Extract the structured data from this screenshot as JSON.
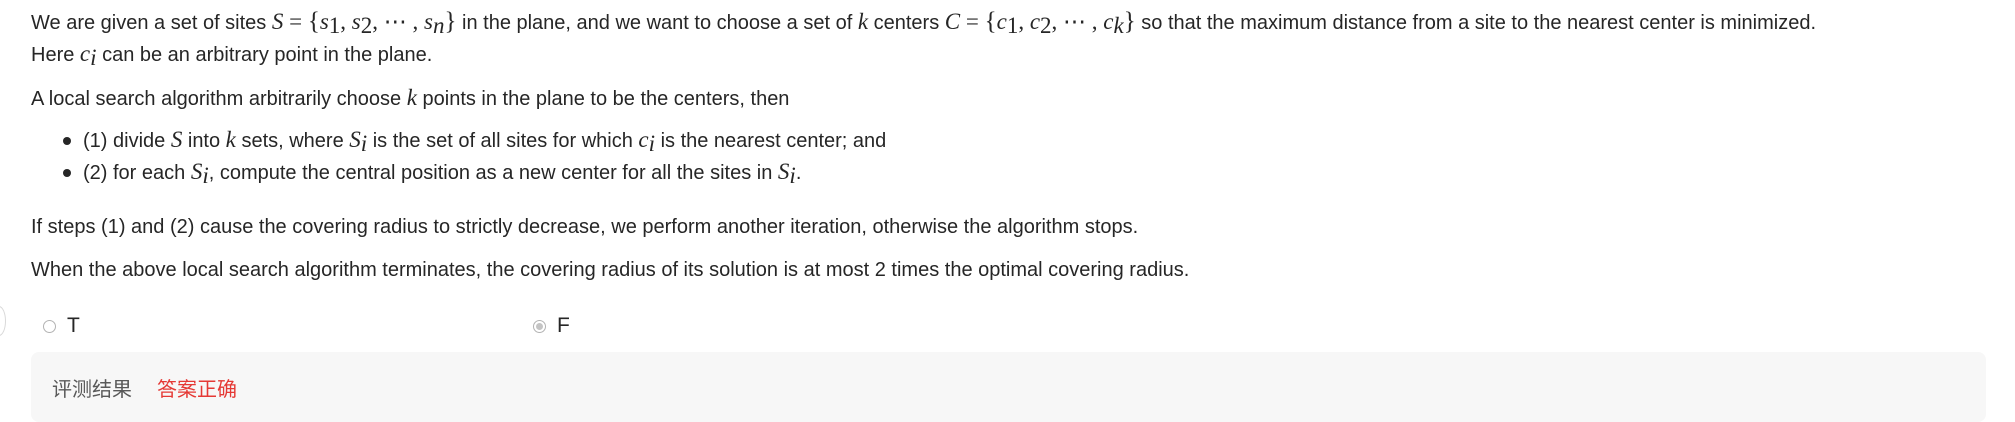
{
  "question": {
    "p1_line1": {
      "t1": "We are given a set of sites ",
      "S": "S",
      "eq": " = ",
      "lbrace": "{",
      "s1": "s",
      "s1_sub": "1",
      "comma1": ", ",
      "s2": "s",
      "s2_sub": "2",
      "comma2": ", ",
      "cdots": "⋯",
      "comma3": " , ",
      "sn": "s",
      "sn_sub": "n",
      "rbrace": "}",
      "t2": " in the plane, and we want to choose a set of ",
      "k": "k",
      "t3": " centers ",
      "C": "C",
      "eq2": " = ",
      "lbrace2": "{",
      "c1": "c",
      "c1_sub": "1",
      "commac1": ", ",
      "c2": "c",
      "c2_sub": "2",
      "commac2": ", ",
      "cdots2": "⋯",
      "commac3": " , ",
      "ck": "c",
      "ck_sub": "k",
      "rbrace2": "}",
      "t4": " so that the maximum distance from a site to the nearest center is minimized."
    },
    "p1_line2": {
      "t1": "Here ",
      "ci": "c",
      "ci_sub": "i",
      "t2": " can be an arbitrary point in the plane."
    },
    "p2": {
      "t1": "A local search algorithm arbitrarily choose ",
      "k": "k",
      "t2": " points in the plane to be the centers, then"
    },
    "li1": {
      "t1": "(1) divide ",
      "S": "S",
      "t2": " into ",
      "k": "k",
      "t3": " sets, where ",
      "Si": "S",
      "Si_sub": "i",
      "t4": " is the set of all sites for which ",
      "ci": "c",
      "ci_sub": "i",
      "t5": " is the nearest center; and"
    },
    "li2": {
      "t1": "(2) for each ",
      "Si": "S",
      "Si_sub": "i",
      "t2": ", compute the central position as a new center for all the sites in ",
      "Si2": "S",
      "Si2_sub": "i",
      "t3": "."
    },
    "p3": "If steps (1) and (2) cause the covering radius to strictly decrease, we perform another iteration, otherwise the algorithm stops.",
    "p4": "When the above local search algorithm terminates, the covering radius of its solution is at most 2 times the optimal covering radius."
  },
  "options": {
    "t_label": "T",
    "f_label": "F",
    "selected": "F"
  },
  "result": {
    "label": "评测结果",
    "value": "答案正确",
    "value_color": "#e53935"
  }
}
